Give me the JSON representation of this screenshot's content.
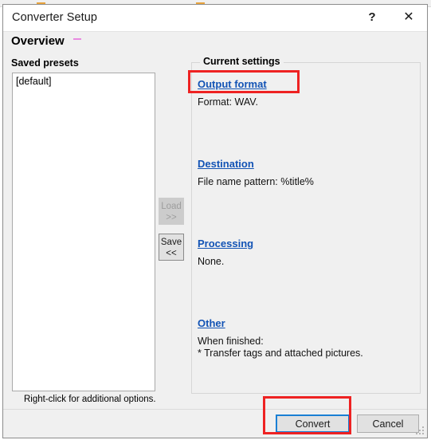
{
  "window": {
    "title": "Converter Setup",
    "help_label": "?",
    "close_label": "✕"
  },
  "header": {
    "title": "Overview"
  },
  "left_panel": {
    "label": "Saved presets",
    "presets": [
      "[default]"
    ],
    "hint": "Right-click for additional options."
  },
  "transfer_buttons": {
    "load": "Load\n>>",
    "save": "Save\n<<"
  },
  "settings_group": {
    "legend": "Current settings",
    "sections": [
      {
        "link": "Output format",
        "body": "Format: WAV."
      },
      {
        "link": "Destination",
        "body": "File name pattern: %title%"
      },
      {
        "link": "Processing",
        "body": "None."
      },
      {
        "link": "Other",
        "body": "When finished:\n* Transfer tags and attached pictures."
      }
    ]
  },
  "footer": {
    "convert": "Convert",
    "cancel": "Cancel"
  },
  "annotations": {
    "color": "#ee2222",
    "boxes": [
      "output-format-link",
      "convert-button"
    ]
  },
  "colors": {
    "link": "#1253b5",
    "focus_border": "#1a7fd4",
    "dialog_background": "#f0f0f0",
    "overview_mark": "#e88ae0"
  }
}
